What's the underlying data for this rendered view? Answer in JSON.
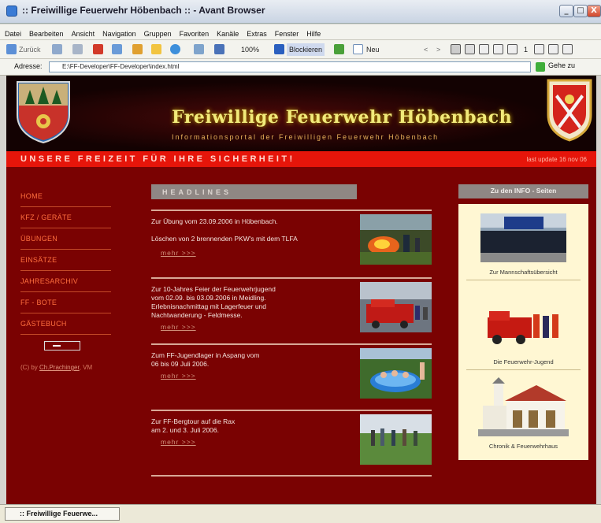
{
  "window": {
    "title": ":: Freiwillige Feuerwehr Höbenbach :: - Avant Browser",
    "controls": [
      "_",
      "□",
      "X"
    ]
  },
  "menu": [
    "Datei",
    "Bearbeiten",
    "Ansicht",
    "Navigation",
    "Gruppen",
    "Favoriten",
    "Kanäle",
    "Extras",
    "Fenster",
    "Hilfe"
  ],
  "toolbar": {
    "back_label": "Zurück",
    "zoom": "100%",
    "block_label": "Blockieren",
    "new_label": "Neu",
    "page_indicator": "1"
  },
  "address": {
    "label": "Adresse:",
    "value": "E:\\FF-Developer\\FF-Developer\\index.html",
    "go_label": "Gehe zu"
  },
  "site": {
    "title": "Freiwillige Feuerwehr Höbenbach",
    "subtitle": "Informationsportal der Freiwilligen Feuerwehr Höbenbach",
    "slogan": "UNSERE FREIZEIT FÜR IHRE SICHERHEIT!",
    "last_update": "last update 16 nov 06"
  },
  "nav": [
    "HOME",
    "KFZ / GERÄTE",
    "ÜBUNGEN",
    "EINSÄTZE",
    "JAHRESARCHIV",
    "FF - BOTE",
    "GÄSTEBUCH"
  ],
  "credit": {
    "prefix": "(C) by",
    "author": "Ch.Prachinger",
    "suffix": ", VM"
  },
  "headlines": {
    "header": "HEADLINES",
    "items": [
      {
        "lines": [
          "Zur Übung vom 23.09.2006 in Höbenbach.",
          "",
          "Löschen von 2 brennenden PKW's mit dem TLFA"
        ],
        "more": "mehr >>>"
      },
      {
        "lines": [
          "Zur 10-Jahres Feier der Feuerwehrjugend",
          "vom 02.09. bis 03.09.2006 in Meidling.",
          "Erlebnisnachmittag mit Lagerfeuer und",
          "Nachtwanderung - Feldmesse."
        ],
        "more": "mehr >>>"
      },
      {
        "lines": [
          "Zum FF-Jugendlager  in Aspang vom",
          "06 bis 09 Juli 2006."
        ],
        "more": "mehr >>>"
      },
      {
        "lines": [
          "Zur FF-Bergtour auf die Rax",
          "am 2. und 3. Juli 2006."
        ],
        "more": "mehr >>>"
      }
    ]
  },
  "info": {
    "header": "Zu den INFO - Seiten",
    "items": [
      "Zur Mannschaftsübersicht",
      "Die Feuerwehr-Jugend",
      "Chronik & Feuerwehrhaus"
    ]
  },
  "statusbar": {
    "task_label": ":: Freiwillige Feuerwe..."
  },
  "colors": {
    "page_bg": "#7a0202",
    "header_bg": "#130202",
    "slogan_bar": "#e6150a",
    "nav_text": "#ff6f3e",
    "title_text": "#f1ea7a",
    "info_panel": "#fff7d3"
  }
}
